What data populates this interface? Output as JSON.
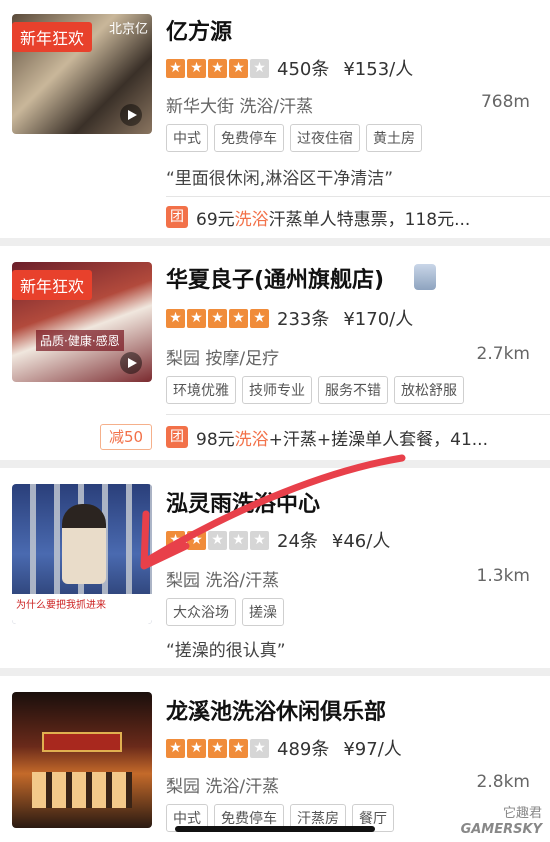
{
  "listings": [
    {
      "name": "亿方源",
      "promo": "新年狂欢",
      "thumb_text": "北京亿",
      "rating": 4,
      "reviews": "450条",
      "price": "¥153/人",
      "area": "新华大街 洗浴/汗蒸",
      "distance": "768m",
      "tags": [
        "中式",
        "免费停车",
        "过夜住宿",
        "黄土房"
      ],
      "quote": "“里面很休闲,淋浴区干净清洁”",
      "deal": {
        "icon": "团",
        "price": "69元",
        "highlight": "洗浴",
        "rest": "汗蒸单人特惠票，118元..."
      }
    },
    {
      "name": "华夏良子(通州旗舰店)",
      "promo": "新年狂欢",
      "thumb_text": "品质·健康·感恩",
      "rating": 5,
      "reviews": "233条",
      "price": "¥170/人",
      "area": "梨园 按摩/足疗",
      "distance": "2.7km",
      "tags": [
        "环境优雅",
        "技师专业",
        "服务不错",
        "放松舒服"
      ],
      "deal": {
        "reduce": "减50",
        "icon": "团",
        "price": "98元",
        "highlight": "洗浴",
        "rest": "+汗蒸+搓澡单人套餐，41..."
      }
    },
    {
      "name": "泓灵雨洗浴中心",
      "thumb_text": "为什么要把我抓进来",
      "rating": 2,
      "reviews": "24条",
      "price": "¥46/人",
      "area": "梨园 洗浴/汗蒸",
      "distance": "1.3km",
      "tags": [
        "大众浴场",
        "搓澡"
      ],
      "quote": "“搓澡的很认真”"
    },
    {
      "name": "龙溪池洗浴休闲俱乐部",
      "rating": 4,
      "reviews": "489条",
      "price": "¥97/人",
      "area": "梨园 洗浴/汗蒸",
      "distance": "2.8km",
      "tags": [
        "中式",
        "免费停车",
        "汗蒸房",
        "餐厅"
      ]
    }
  ],
  "watermark": {
    "line1": "它趣君",
    "line2": "GAMERSKY"
  },
  "colors": {
    "accent": "#f27149",
    "star": "#f08c3a",
    "promo": "#e8412c",
    "arrow": "#e8404a"
  }
}
